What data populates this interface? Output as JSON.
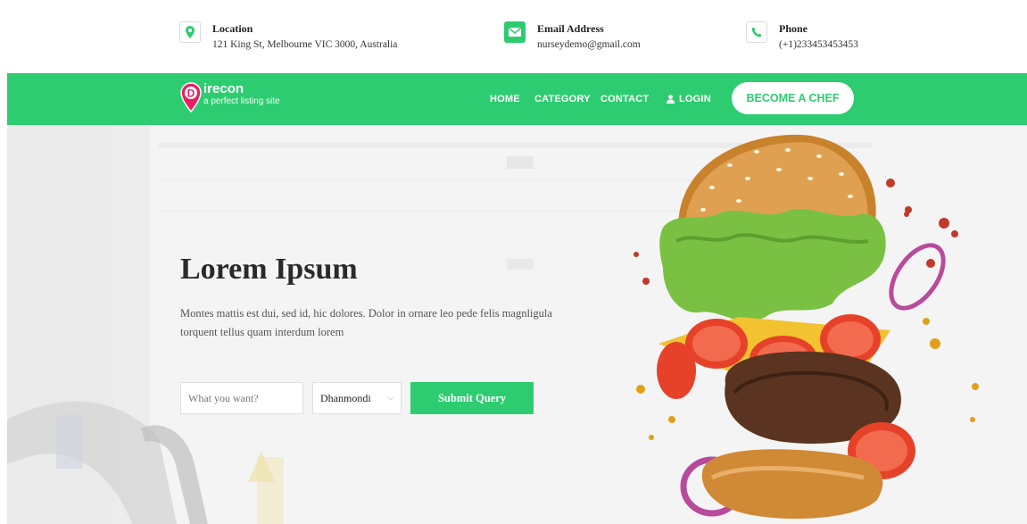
{
  "topbar": {
    "location": {
      "title": "Location",
      "value": "121 King St, Melbourne VIC 3000, Australia",
      "icon": "map-pin-icon"
    },
    "email": {
      "title": "Email Address",
      "value": "nurseydemo@gmail.com",
      "icon": "envelope-icon"
    },
    "phone": {
      "title": "Phone",
      "value": "(+1)233453453453",
      "icon": "phone-icon"
    }
  },
  "nav": {
    "brand": "irecon",
    "brand_letter": "D",
    "tagline": "a perfect listing site",
    "items": [
      {
        "label": "HOME"
      },
      {
        "label": "CATEGORY"
      },
      {
        "label": "CONTACT"
      },
      {
        "label": "LOGIN",
        "icon": "user-icon"
      }
    ],
    "cta": "BECOME A CHEF"
  },
  "hero": {
    "title": "Lorem Ipsum",
    "description": "Montes mattis est dui, sed id, hic dolores. Dolor in ornare leo pede felis magnligula torquent tellus quam interdum lorem",
    "search_placeholder": "What you want?",
    "location_selected": "Dhanmondi",
    "submit": "Submit Query"
  },
  "colors": {
    "accent": "#2ecc71",
    "brand_pink": "#e91e63",
    "text_dark": "#2a2a2a"
  }
}
